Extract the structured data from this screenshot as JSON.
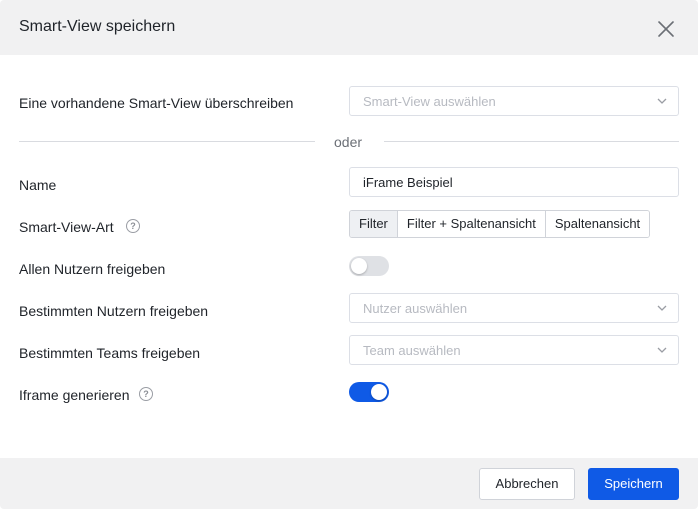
{
  "dialog": {
    "title": "Smart-View speichern",
    "close_icon": "close-icon"
  },
  "overwrite": {
    "label": "Eine vorhandene Smart-View überschreiben",
    "placeholder": "Smart-View auswählen"
  },
  "divider": {
    "text": "oder"
  },
  "name": {
    "label": "Name",
    "value": "iFrame Beispiel"
  },
  "view_type": {
    "label": "Smart-View-Art",
    "help_icon": "help-icon",
    "options": [
      "Filter",
      "Filter + Spaltenansicht",
      "Spaltenansicht"
    ],
    "selected": "Filter"
  },
  "share_all": {
    "label": "Allen Nutzern freigeben",
    "enabled": false
  },
  "share_users": {
    "label": "Bestimmten Nutzern freigeben",
    "placeholder": "Nutzer auswählen"
  },
  "share_teams": {
    "label": "Bestimmten Teams freigeben",
    "placeholder": "Team auswählen"
  },
  "iframe": {
    "label": "Iframe generieren",
    "help_icon": "help-icon",
    "enabled": true
  },
  "footer": {
    "cancel_label": "Abbrechen",
    "save_label": "Speichern"
  },
  "colors": {
    "primary": "#0f5ae6",
    "header_bg": "#f1f1f2",
    "toggle_off": "#dfe1e5"
  }
}
